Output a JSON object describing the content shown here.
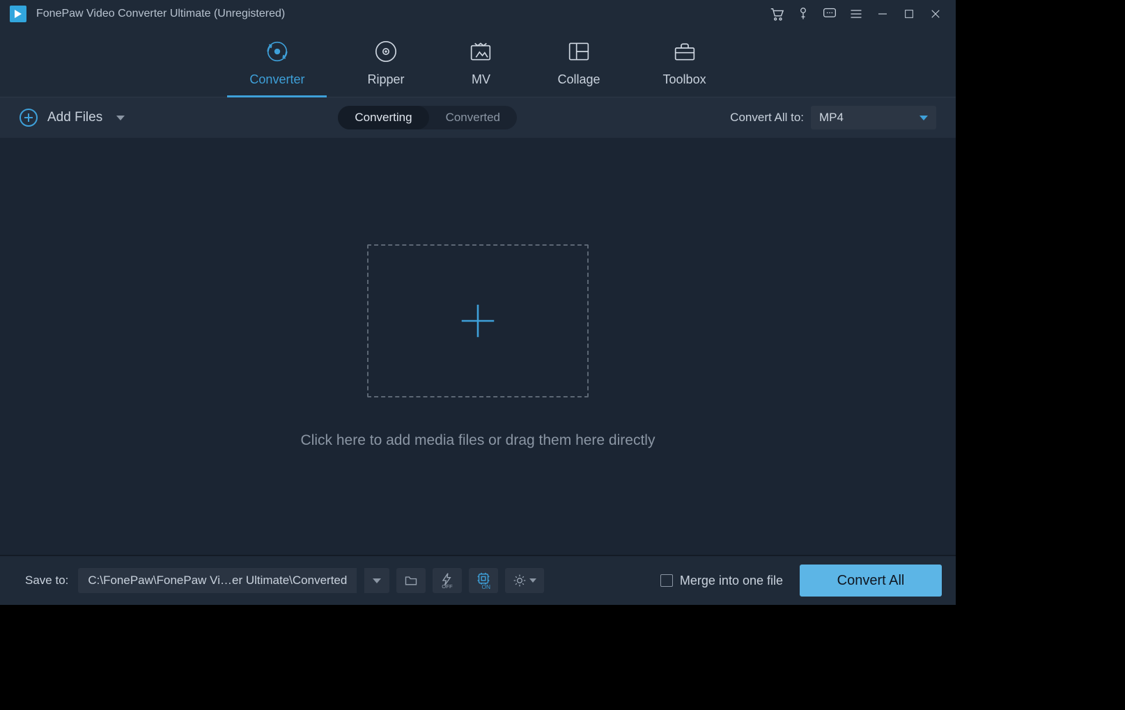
{
  "title": "FonePaw Video Converter Ultimate (Unregistered)",
  "modules": {
    "converter": "Converter",
    "ripper": "Ripper",
    "mv": "MV",
    "collage": "Collage",
    "toolbox": "Toolbox"
  },
  "subbar": {
    "add_files": "Add Files",
    "segment": {
      "converting": "Converting",
      "converted": "Converted"
    },
    "convert_all_to_label": "Convert All to:",
    "format_value": "MP4"
  },
  "main": {
    "hint": "Click here to add media files or drag them here directly"
  },
  "bottom": {
    "save_to_label": "Save to:",
    "save_to_path": "C:\\FonePaw\\FonePaw Vi…er Ultimate\\Converted",
    "merge_label": "Merge into one file",
    "convert_all": "Convert All"
  }
}
